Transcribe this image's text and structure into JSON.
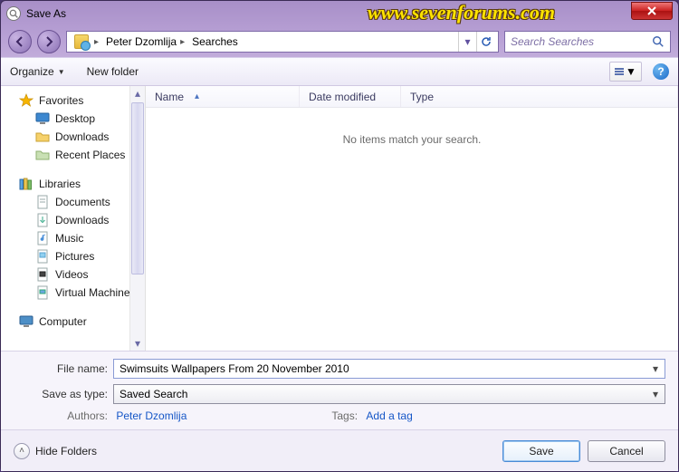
{
  "title": "Save As",
  "watermark": "www.sevenforums.com",
  "nav_back": "◀",
  "nav_fwd": "▶",
  "breadcrumb": {
    "seg1": "Peter Dzomlija",
    "seg2": "Searches"
  },
  "search": {
    "placeholder": "Search Searches"
  },
  "toolbar": {
    "organize": "Organize",
    "newfolder": "New folder",
    "help": "?"
  },
  "tree": {
    "favorites": {
      "label": "Favorites",
      "items": [
        {
          "label": "Desktop"
        },
        {
          "label": "Downloads"
        },
        {
          "label": "Recent Places"
        }
      ]
    },
    "libraries": {
      "label": "Libraries",
      "items": [
        {
          "label": "Documents"
        },
        {
          "label": "Downloads"
        },
        {
          "label": "Music"
        },
        {
          "label": "Pictures"
        },
        {
          "label": "Videos"
        },
        {
          "label": "Virtual Machines"
        }
      ]
    },
    "computer": {
      "label": "Computer"
    }
  },
  "columns": {
    "name": "Name",
    "date": "Date modified",
    "type": "Type"
  },
  "empty_msg": "No items match your search.",
  "form": {
    "filename_label": "File name:",
    "filename_value": "Swimsuits Wallpapers From 20 November 2010",
    "savetype_label": "Save as type:",
    "savetype_value": "Saved Search",
    "authors_label": "Authors:",
    "authors_value": "Peter Dzomlija",
    "tags_label": "Tags:",
    "tags_value": "Add a tag"
  },
  "footer": {
    "hide": "Hide Folders",
    "save": "Save",
    "cancel": "Cancel"
  }
}
